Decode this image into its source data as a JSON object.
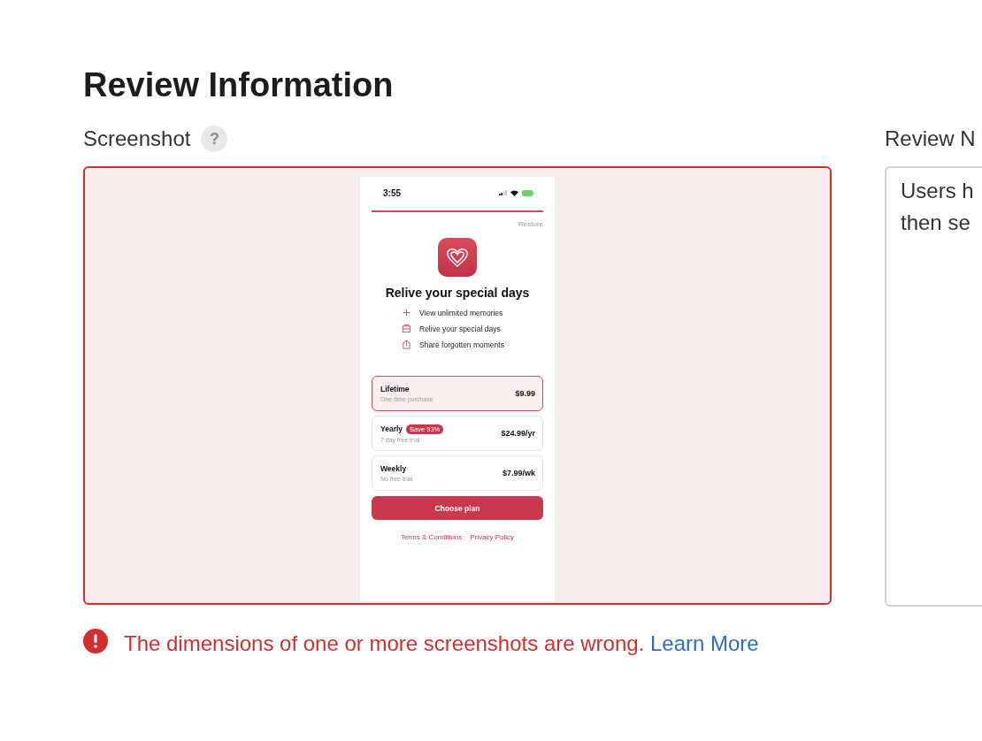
{
  "heading": "Review Information",
  "screenshot_section": {
    "label": "Screenshot",
    "help": "?",
    "invalid": true,
    "phone": {
      "time": "3:55",
      "restore": "Restore",
      "title": "Relive your special days",
      "features": [
        {
          "kind": "sparkle",
          "text": "View unlimited memories"
        },
        {
          "kind": "album",
          "text": "Relive your special days"
        },
        {
          "kind": "share",
          "text": "Share forgotten moments"
        }
      ],
      "plans": [
        {
          "name": "Lifetime",
          "note": "One-time purchase",
          "price": "$9.99",
          "selected": true
        },
        {
          "name": "Yearly",
          "badge": "Save 93%",
          "note": "7 day free trial",
          "price": "$24.99/yr",
          "selected": false
        },
        {
          "name": "Weekly",
          "note": "No free trial",
          "price": "$7.99/wk",
          "selected": false
        }
      ],
      "cta": "Choose plan",
      "links": [
        "Terms & Conditions",
        "Privacy Policy"
      ]
    }
  },
  "error": {
    "message": "The dimensions of one or more screenshots are wrong.",
    "link": "Learn More"
  },
  "review_notes": {
    "label": "Review N",
    "lines": [
      "Users h",
      "then se"
    ]
  }
}
